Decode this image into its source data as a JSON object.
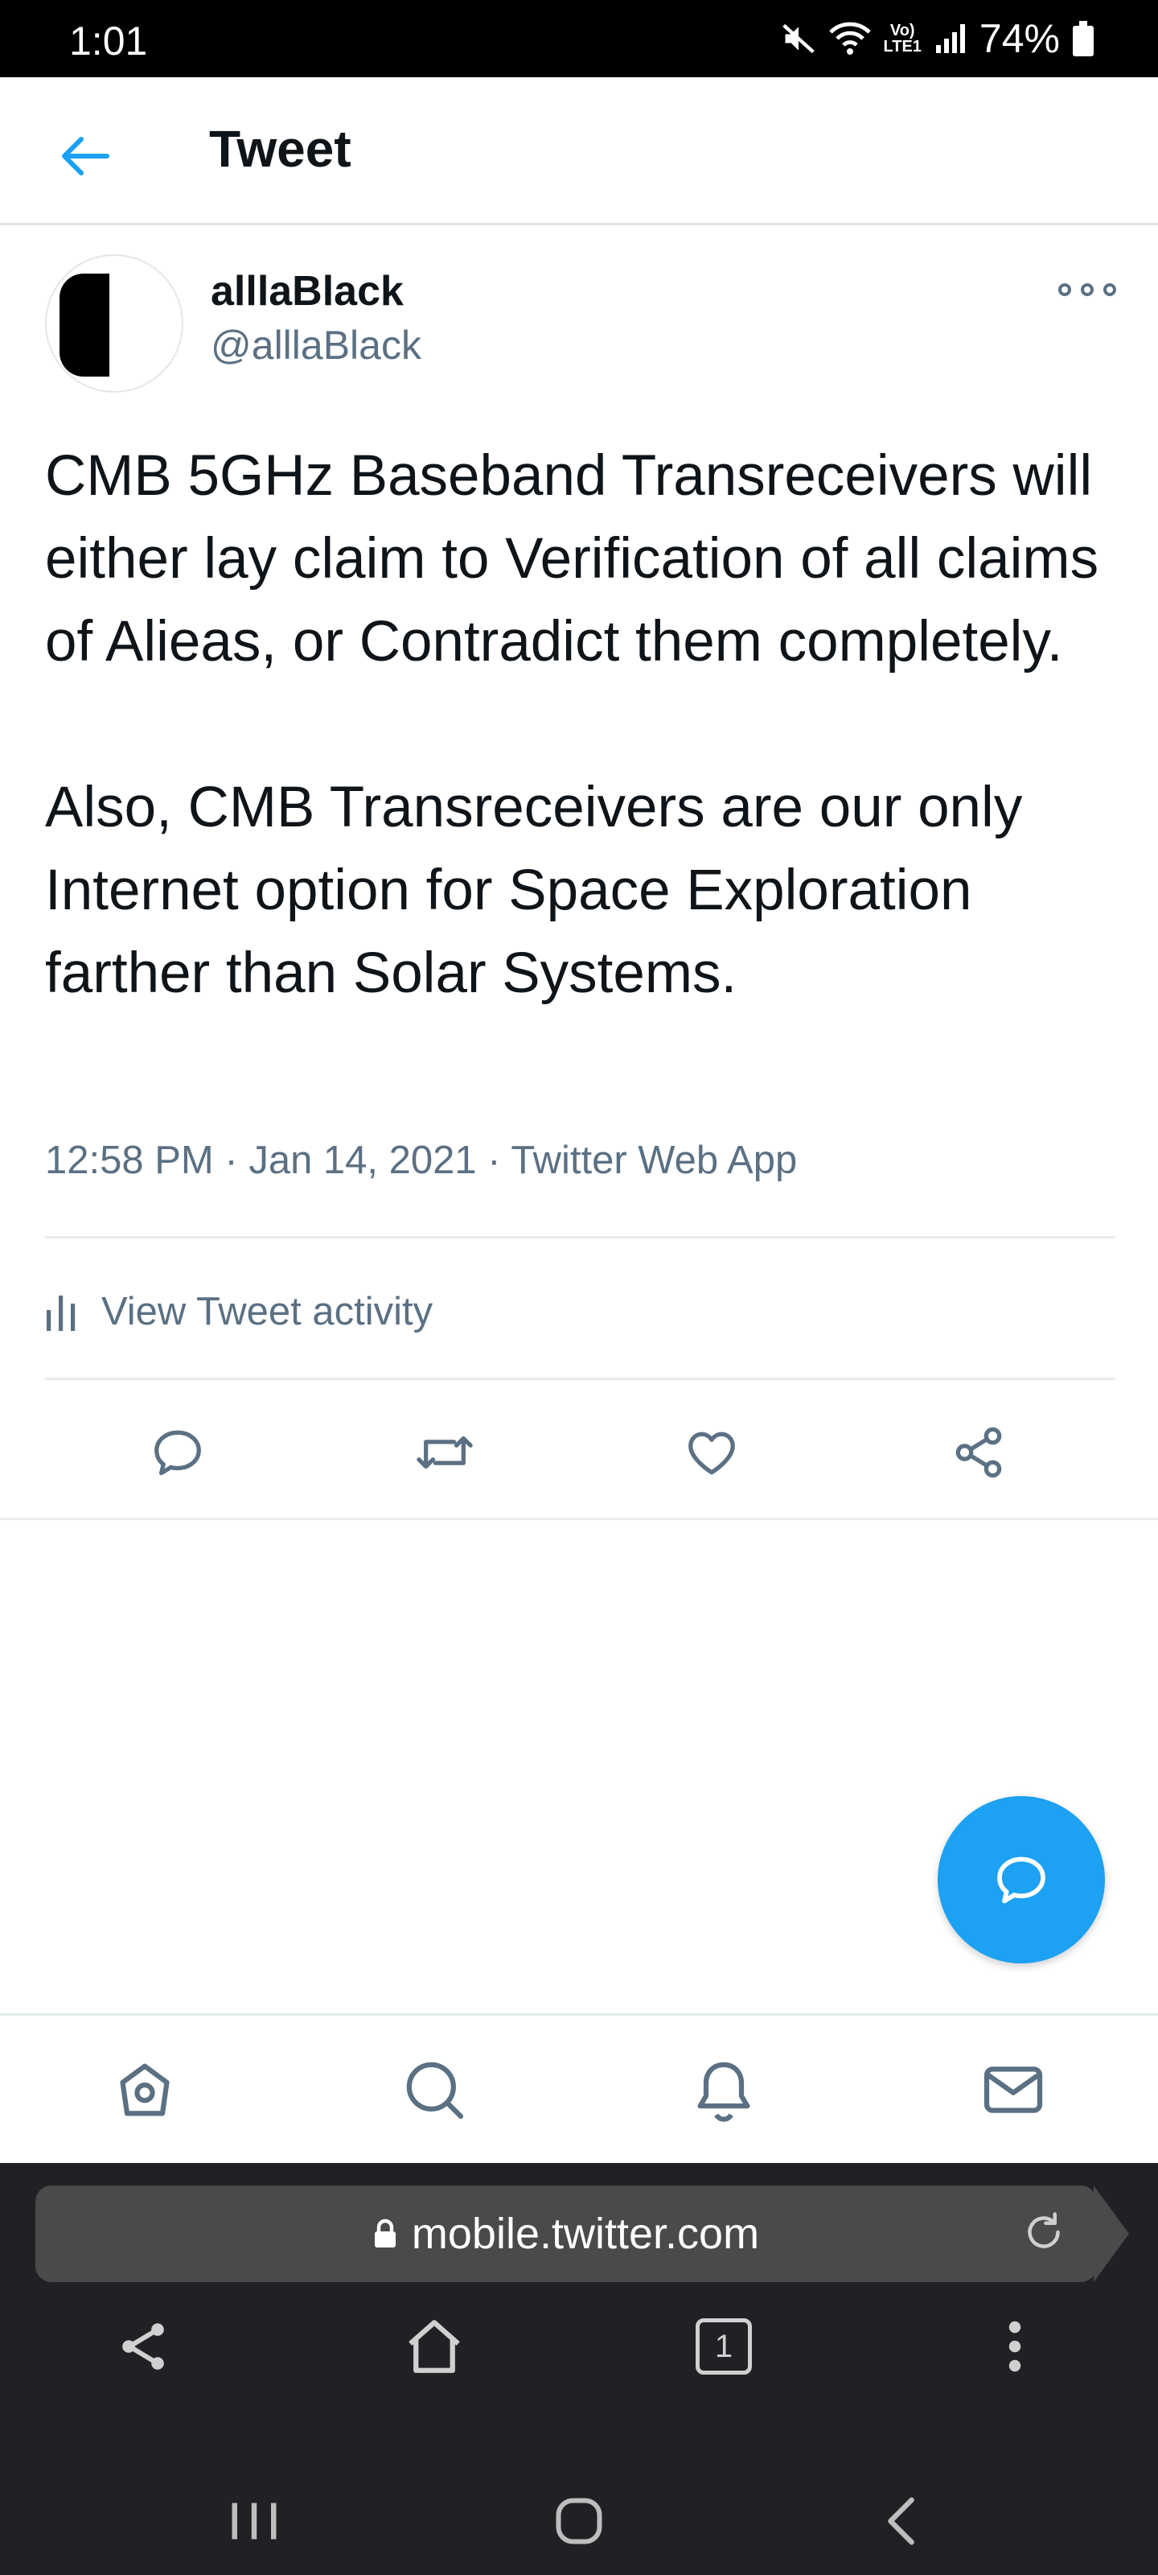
{
  "status_bar": {
    "time": "1:01",
    "battery": "74%",
    "network_label_top": "Vo)",
    "network_label_bottom": "LTE1"
  },
  "header": {
    "title": "Tweet"
  },
  "tweet": {
    "display_name": "alllaBlack",
    "handle": "@alllaBlack",
    "text": "CMB 5GHz Baseband Transreceivers will either lay claim to Verification of all claims of Alieas, or Contradict them completely.\n\nAlso, CMB Transreceivers are our only Internet option for Space Exploration farther than Solar Systems.",
    "time": "12:58 PM",
    "separator": "·",
    "date": "Jan 14, 2021",
    "source": "Twitter Web App",
    "activity_label": "View Tweet activity"
  },
  "actions": [
    "reply-icon",
    "retweet-icon",
    "like-icon",
    "share-icon"
  ],
  "bottom_nav": [
    "home-icon",
    "search-icon",
    "notifications-icon",
    "messages-icon"
  ],
  "browser": {
    "url": "mobile.twitter.com",
    "tab_count": "1"
  },
  "colors": {
    "accent": "#1da1f2",
    "text_primary": "#0f1419",
    "text_secondary": "#5b7083",
    "divider": "#e6ecf0",
    "browser_bg": "#202124"
  }
}
